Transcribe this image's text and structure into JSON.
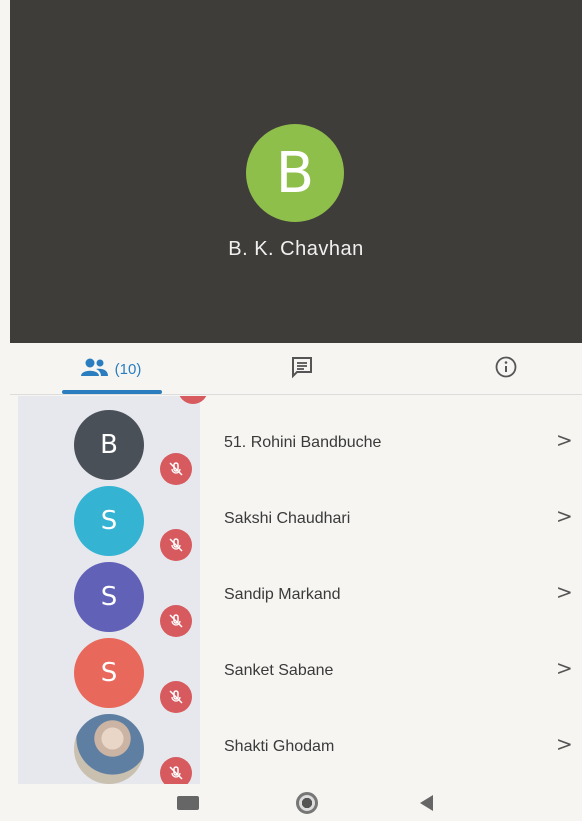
{
  "active_speaker": {
    "initial": "B",
    "name": "B. K. Chavhan",
    "avatar_color": "#8fbf4b"
  },
  "tabs": {
    "participants_count": "(10)",
    "active_tab": "participants",
    "icons": [
      "people-icon",
      "chat-icon",
      "info-icon"
    ],
    "accent_color": "#2a7ec0"
  },
  "participants": [
    {
      "initial": "B",
      "name": "51. Rohini Bandbuche",
      "avatar_color": "#4a5058",
      "muted": true
    },
    {
      "initial": "S",
      "name": "Sakshi Chaudhari",
      "avatar_color": "#34b3d3",
      "muted": true
    },
    {
      "initial": "S",
      "name": "Sandip Markand",
      "avatar_color": "#6261b8",
      "muted": true
    },
    {
      "initial": "S",
      "name": "Sanket Sabane",
      "avatar_color": "#e8685b",
      "muted": true
    },
    {
      "initial": "",
      "name": "Shakti Ghodam",
      "avatar_color": "photo",
      "muted": true
    }
  ],
  "muted_icon_color": "#d65a5e",
  "chevron": ">",
  "navbar": {
    "icons": [
      "recents-icon",
      "home-icon",
      "back-icon"
    ]
  }
}
